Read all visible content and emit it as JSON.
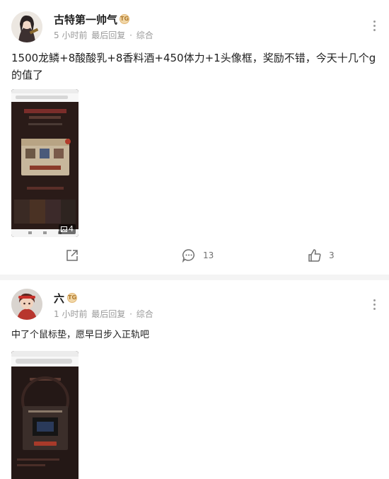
{
  "posts": [
    {
      "author": "古特第一帅气",
      "badge": "TG",
      "time": "5 小时前",
      "last_reply": "最后回复",
      "separator": "·",
      "category": "综合",
      "content": "1500龙鳞+8酸酸乳+8香料酒+450体力+1头像框，奖励不错，今天十几个g的值了",
      "image_count": "4",
      "comments": "13",
      "likes": "3"
    },
    {
      "author": "六",
      "badge": "TG",
      "time": "1 小时前",
      "last_reply": "最后回复",
      "separator": "·",
      "category": "综合",
      "content": "中了个鼠标垫，愿早日步入正轨吧"
    }
  ],
  "icons": {
    "more": "more-vertical-icon",
    "share": "share-icon",
    "comment": "comment-icon",
    "like": "thumbs-up-icon",
    "image": "image-icon"
  }
}
